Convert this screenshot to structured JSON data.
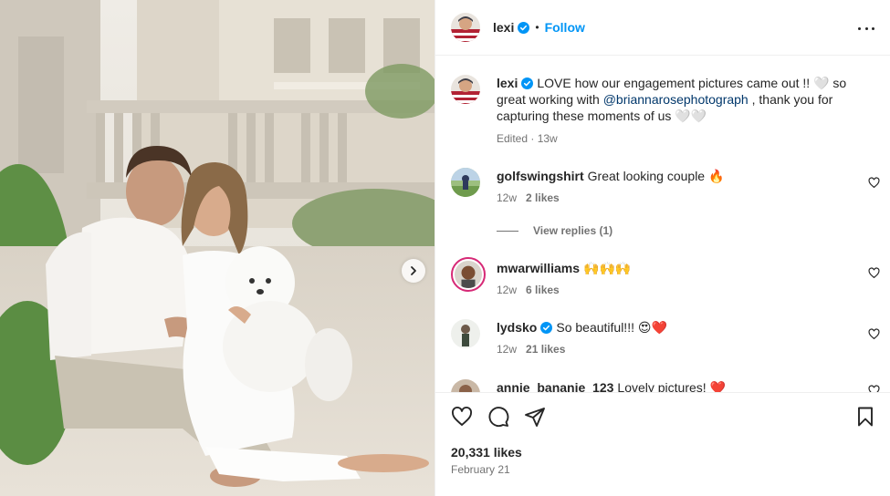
{
  "post": {
    "author": "lexi",
    "follow_label": "Follow",
    "dot": "•"
  },
  "caption": {
    "username": "lexi",
    "text_before": "LOVE how our engagement pictures came out !! 🤍 so great working with ",
    "mention": "@briannarosephotograph",
    "text_after": " , thank you for capturing these moments of us 🤍🤍",
    "edited": "Edited · 13w"
  },
  "comments": [
    {
      "username": "golfswingshirt",
      "text": "Great looking couple 🔥",
      "age": "12w",
      "likes": "2 likes",
      "replies": "View replies (1)"
    },
    {
      "username": "mwarwilliams",
      "text": "🙌🙌🙌",
      "age": "12w",
      "likes": "6 likes"
    },
    {
      "username": "lydsko",
      "text": "So beautiful!!! 😍❤️",
      "age": "12w",
      "likes": "21 likes"
    },
    {
      "username": "annie_bananie_123",
      "text": "Lovely pictures! ❤️"
    }
  ],
  "stats": {
    "likes": "20,331 likes",
    "date": "February 21"
  },
  "icons": {
    "more": "more-options-icon",
    "like": "heart-icon",
    "comment": "comment-icon",
    "share": "share-icon",
    "save": "bookmark-icon",
    "verified": "verified-badge-icon",
    "next": "chevron-right-icon"
  },
  "colors": {
    "link": "#0095f6",
    "verified": "#0095f6",
    "mention": "#00376b",
    "muted": "#737373",
    "text": "#262626"
  }
}
